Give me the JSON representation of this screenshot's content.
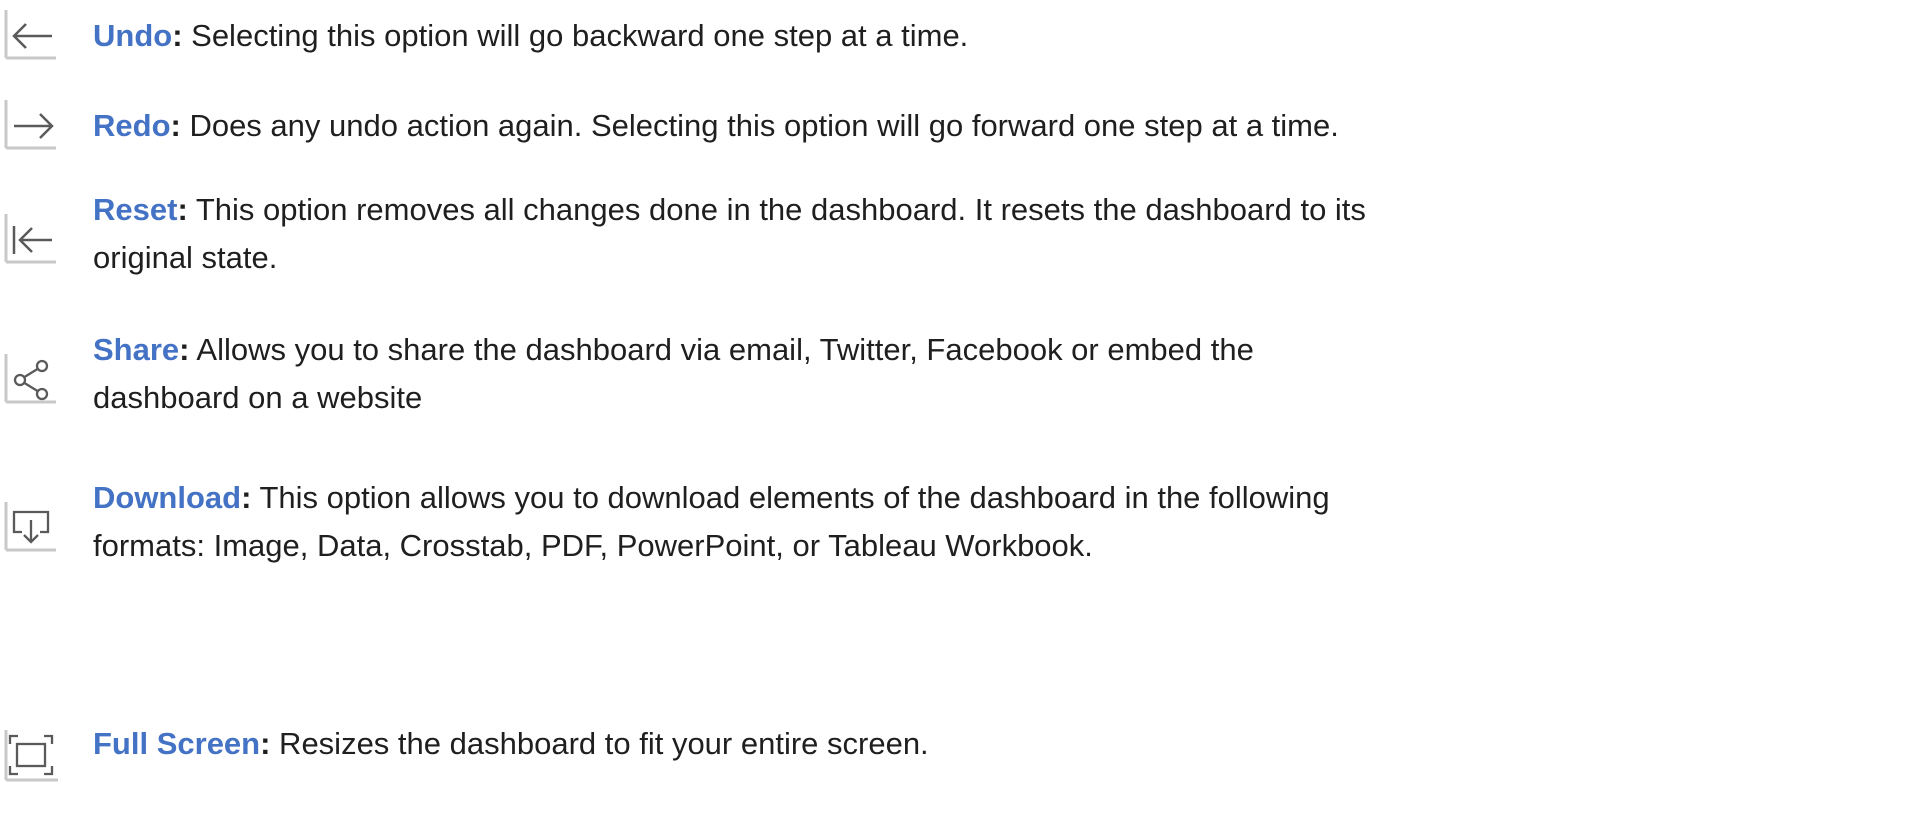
{
  "items": [
    {
      "icon": "undo-arrow-icon",
      "term": "Undo",
      "colon": ":",
      "lines": [
        " Selecting this option will go backward one step at a time."
      ]
    },
    {
      "icon": "redo-arrow-icon",
      "term": "Redo",
      "colon": ":",
      "lines": [
        " Does any undo action again. Selecting this option will go forward one step at a time."
      ]
    },
    {
      "icon": "reset-arrow-icon",
      "term": "Reset",
      "colon": ":",
      "lines": [
        " This option removes all changes done in the dashboard. It resets the dashboard to its",
        "original state."
      ]
    },
    {
      "icon": "share-icon",
      "term": "Share",
      "colon": ":",
      "lines": [
        " Allows you to share the dashboard via email, Twitter, Facebook or embed the",
        "dashboard on a website"
      ]
    },
    {
      "icon": "download-icon",
      "term": "Download",
      "colon": ":",
      "lines": [
        " This option allows you to download elements of the dashboard in the following",
        "formats: Image, Data, Crosstab, PDF, PowerPoint, or Tableau Workbook."
      ]
    },
    {
      "icon": "full-screen-icon",
      "term": "Full Screen",
      "colon": ":",
      "lines": [
        " Resizes the dashboard to fit your entire screen."
      ]
    }
  ],
  "colors": {
    "term": "#4472c4",
    "text": "#1f1f1f",
    "icon": "#5a5a5a",
    "icon_shadow": "#c8c8c8"
  }
}
